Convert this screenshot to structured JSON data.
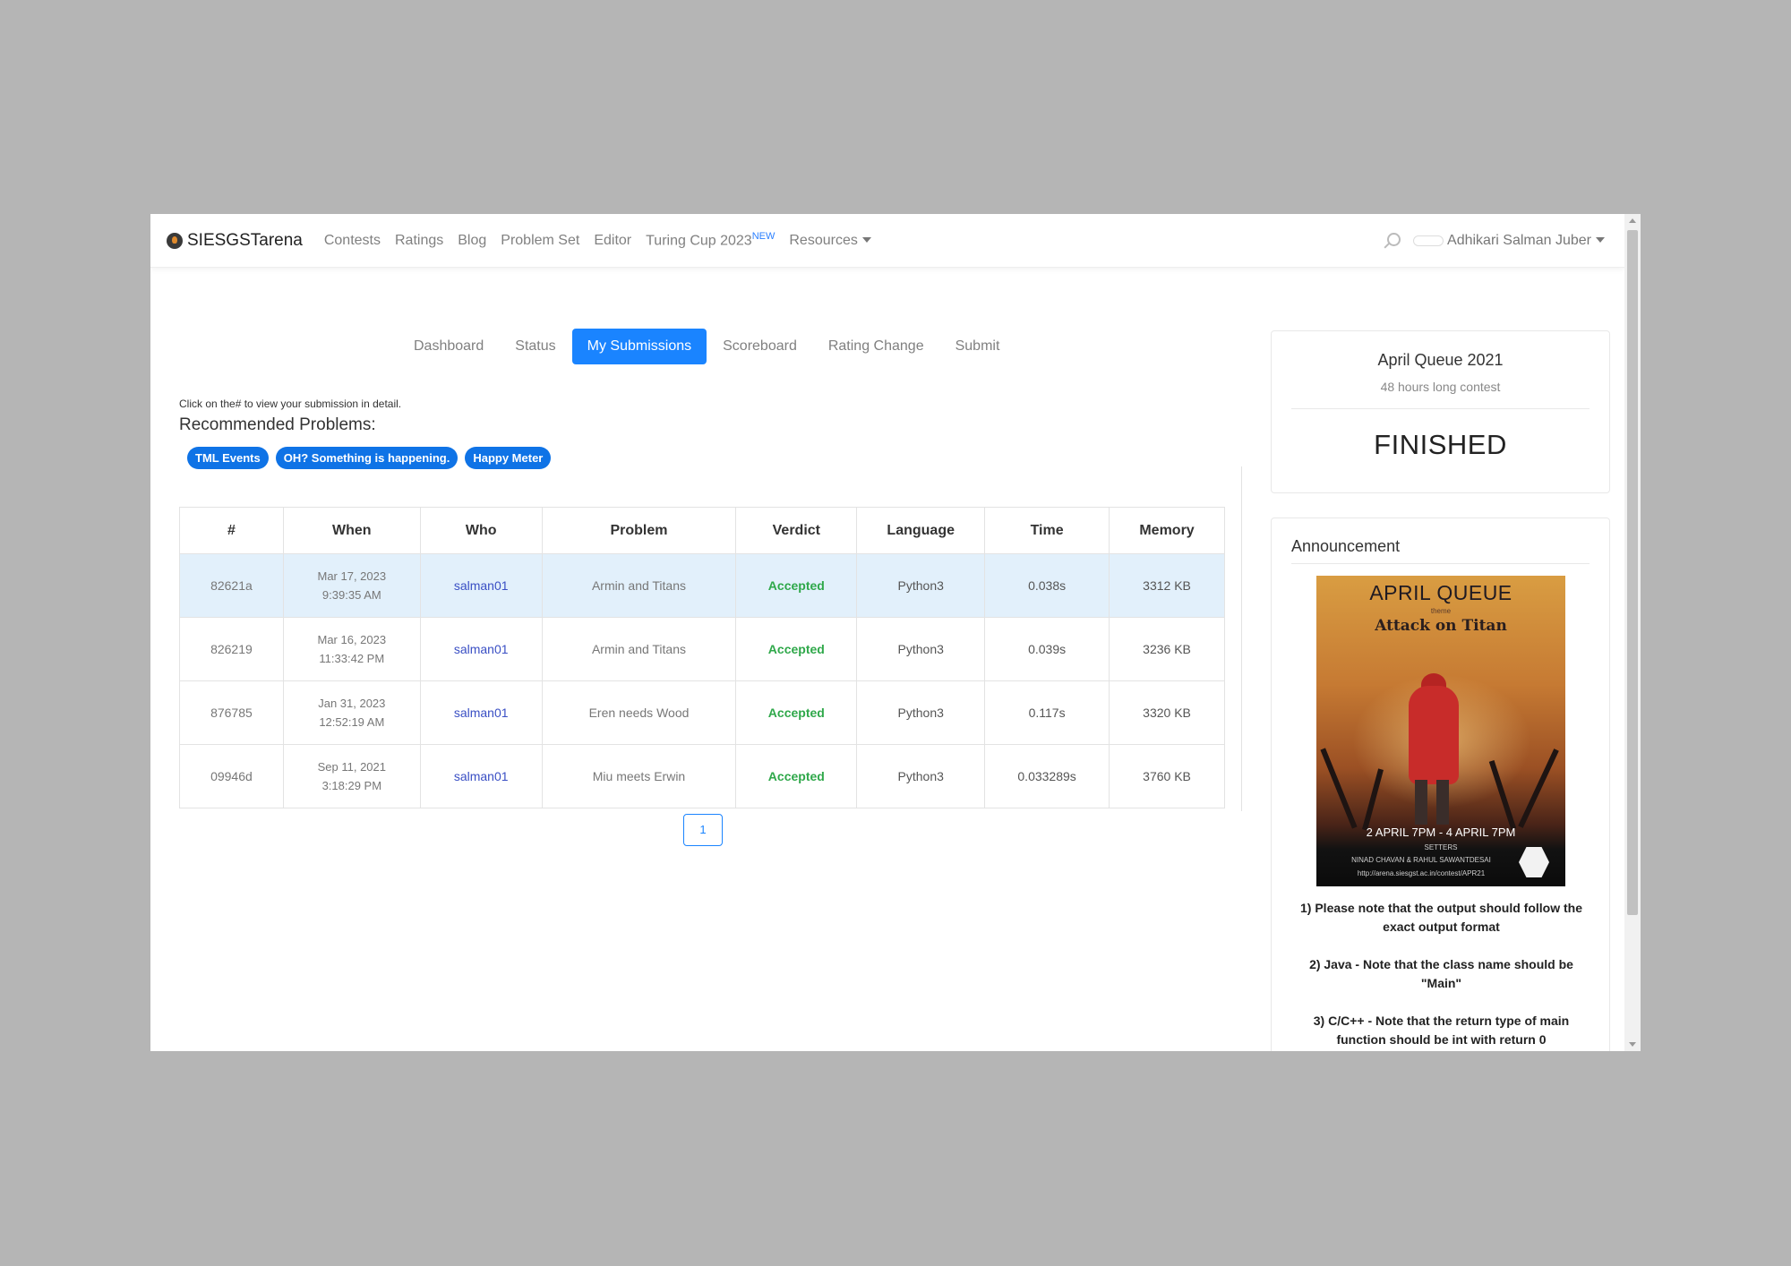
{
  "nav": {
    "brand": "SIESGSTarena",
    "links": [
      "Contests",
      "Ratings",
      "Blog",
      "Problem Set",
      "Editor"
    ],
    "turing": "Turing Cup 2023",
    "turing_badge": "NEW",
    "resources": "Resources",
    "user": "Adhikari Salman Juber"
  },
  "tabs": [
    "Dashboard",
    "Status",
    "My Submissions",
    "Scoreboard",
    "Rating Change",
    "Submit"
  ],
  "hint": "Click on the# to view your submission in detail.",
  "recommended": {
    "title": "Recommended Problems:",
    "items": [
      "TML Events",
      "OH? Something is happening.",
      "Happy Meter"
    ]
  },
  "table": {
    "headers": [
      "#",
      "When",
      "Who",
      "Problem",
      "Verdict",
      "Language",
      "Time",
      "Memory"
    ],
    "rows": [
      {
        "id": "82621a",
        "date": "Mar 17, 2023",
        "time": "9:39:35 AM",
        "who": "salman01",
        "problem": "Armin and Titans",
        "verdict": "Accepted",
        "lang": "Python3",
        "exec": "0.038s",
        "mem": "3312 KB"
      },
      {
        "id": "826219",
        "date": "Mar 16, 2023",
        "time": "11:33:42 PM",
        "who": "salman01",
        "problem": "Armin and Titans",
        "verdict": "Accepted",
        "lang": "Python3",
        "exec": "0.039s",
        "mem": "3236 KB"
      },
      {
        "id": "876785",
        "date": "Jan 31, 2023",
        "time": "12:52:19 AM",
        "who": "salman01",
        "problem": "Eren needs Wood",
        "verdict": "Accepted",
        "lang": "Python3",
        "exec": "0.117s",
        "mem": "3320 KB"
      },
      {
        "id": "09946d",
        "date": "Sep 11, 2021",
        "time": "3:18:29 PM",
        "who": "salman01",
        "problem": "Miu meets Erwin",
        "verdict": "Accepted",
        "lang": "Python3",
        "exec": "0.033289s",
        "mem": "3760 KB"
      }
    ]
  },
  "pagination": {
    "page": "1"
  },
  "contest": {
    "title": "April Queue 2021",
    "subtitle": "48 hours long contest",
    "status": "FINISHED"
  },
  "announcement": {
    "title": "Announcement",
    "poster": {
      "heading": "APRIL QUEUE",
      "theme": "theme",
      "logo": "Attack on Titan",
      "dates": "2 APRIL 7PM - 4 APRIL 7PM",
      "setters_label": "SETTERS",
      "setters": "NINAD CHAVAN & RAHUL SAWANTDESAI",
      "url": "http://arena.siesgst.ac.in/contest/APR21"
    },
    "notes": [
      "1) Please note that the output should follow the exact output format",
      "2) Java - Note that the class name should be \"Main\"",
      "3) C/C++ - Note that the return type of main function should be int with return 0"
    ]
  },
  "colors": {
    "primary": "#1a84ff",
    "accepted": "#2fa84a",
    "link": "#3a4fc4",
    "highlight_row": "#e2f0fb"
  }
}
